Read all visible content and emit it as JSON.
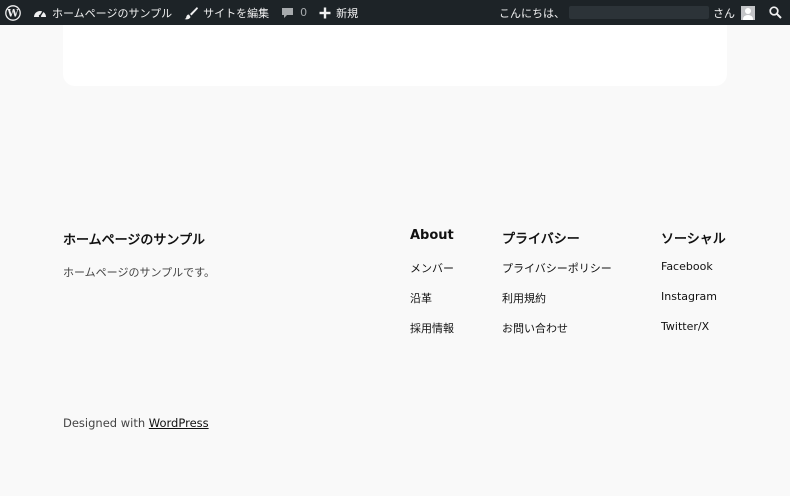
{
  "adminbar": {
    "site_name": "ホームページのサンプル",
    "edit_site": "サイトを編集",
    "comments_count": "0",
    "new_label": "新規",
    "greeting": "こんにちは、",
    "user_suffix": "さん",
    "colors": {
      "bar_bg": "#1d2327",
      "bar_text": "#f0f0f1"
    }
  },
  "footer": {
    "site_title": "ホームページのサンプル",
    "site_description": "ホームページのサンプルです。",
    "columns": [
      {
        "heading": "About",
        "links": [
          "メンバー",
          "沿革",
          "採用情報"
        ]
      },
      {
        "heading": "プライバシー",
        "links": [
          "プライバシーポリシー",
          "利用規約",
          "お問い合わせ"
        ]
      },
      {
        "heading": "ソーシャル",
        "links": [
          "Facebook",
          "Instagram",
          "Twitter/X"
        ]
      }
    ],
    "credit_prefix": "Designed with ",
    "credit_link": "WordPress"
  },
  "icons": [
    "wordpress-icon",
    "dashboard-icon",
    "brush-icon",
    "comment-icon",
    "plus-icon",
    "search-icon",
    "avatar-icon"
  ]
}
